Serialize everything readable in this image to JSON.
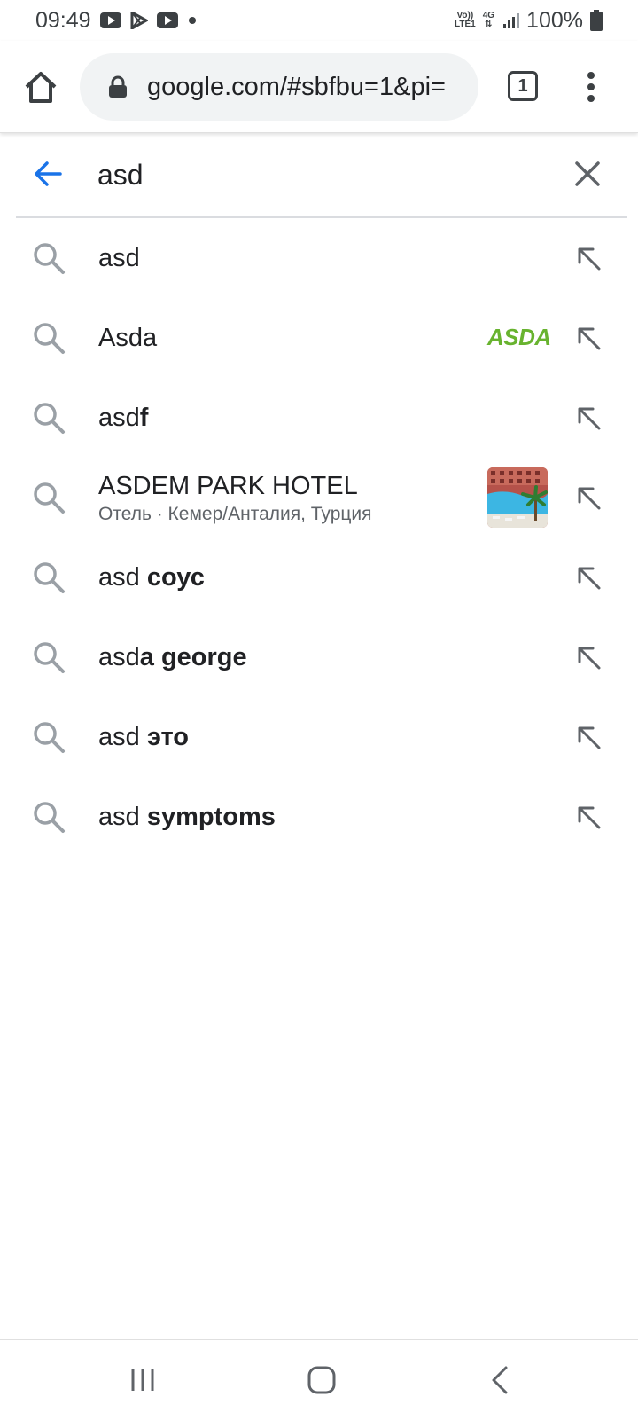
{
  "status_bar": {
    "time": "09:49",
    "left_icons": [
      "youtube-icon",
      "play-store-icon",
      "youtube-icon",
      "dot-icon"
    ],
    "network_top": "Vo))",
    "network_bottom": "LTE1",
    "network_type": "4G",
    "battery": "100%"
  },
  "browser": {
    "url": "google.com/#sbfbu=1&pi=",
    "tab_count": "1"
  },
  "search": {
    "query": "asd"
  },
  "suggestions": [
    {
      "prefix": "asd",
      "bold": "",
      "icon": "search-icon",
      "arrow": "insert-arrow-icon"
    },
    {
      "prefix": "Asda",
      "bold": "",
      "logo": "ASDA",
      "icon": "search-icon",
      "arrow": "insert-arrow-icon"
    },
    {
      "prefix": "asd",
      "bold": "f",
      "icon": "search-icon",
      "arrow": "insert-arrow-icon"
    },
    {
      "title": "ASDEM PARK HOTEL",
      "subtitle": "Отель · Кемер/Анталия, Турция",
      "thumbnail": "hotel-pool-thumbnail",
      "icon": "search-icon",
      "arrow": "insert-arrow-icon"
    },
    {
      "prefix": "asd ",
      "bold": "соус",
      "icon": "search-icon",
      "arrow": "insert-arrow-icon"
    },
    {
      "prefix": "asd",
      "bold": "a george",
      "icon": "search-icon",
      "arrow": "insert-arrow-icon"
    },
    {
      "prefix": "asd ",
      "bold": "это",
      "icon": "search-icon",
      "arrow": "insert-arrow-icon"
    },
    {
      "prefix": "asd ",
      "bold": "symptoms",
      "icon": "search-icon",
      "arrow": "insert-arrow-icon"
    }
  ],
  "colors": {
    "accent_blue": "#1a73e8",
    "asda_green": "#68b32f",
    "icon_gray": "#5f6368"
  }
}
